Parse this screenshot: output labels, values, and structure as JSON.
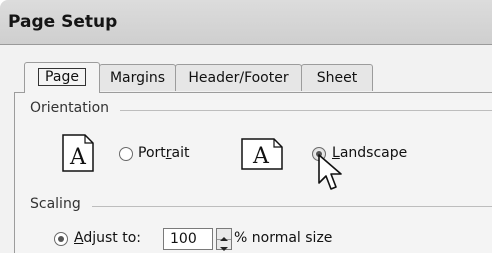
{
  "dialog": {
    "title": "Page Setup"
  },
  "tabs": [
    {
      "label": "Page",
      "active": true
    },
    {
      "label": "Margins",
      "active": false
    },
    {
      "label": "Header/Footer",
      "active": false
    },
    {
      "label": "Sheet",
      "active": false
    }
  ],
  "orientation": {
    "group_label": "Orientation",
    "portrait_icon_letter": "A",
    "landscape_icon_letter": "A",
    "portrait": {
      "pre": "Port",
      "accel": "r",
      "post": "ait",
      "selected": false
    },
    "landscape": {
      "pre": "",
      "accel": "L",
      "post": "andscape",
      "selected": true
    }
  },
  "scaling": {
    "group_label": "Scaling",
    "adjust_to": {
      "pre": "",
      "accel": "A",
      "post": "djust to:",
      "selected": true
    },
    "value": "100",
    "suffix": "% normal size"
  }
}
